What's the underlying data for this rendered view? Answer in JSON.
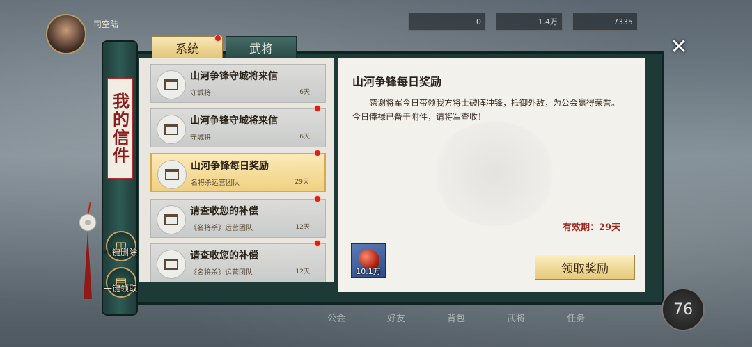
{
  "hud": {
    "player_name": "司空陆",
    "currency1": "0",
    "currency2": "1.4万",
    "currency3": "7335"
  },
  "left_scroll": {
    "title": "我的信件",
    "delete_all_label": "一键删除",
    "claim_all_label": "一键领取"
  },
  "tabs": [
    {
      "label": "系统",
      "active": true
    },
    {
      "label": "武将",
      "active": false
    }
  ],
  "mails": [
    {
      "title": "山河争锋守城将来信",
      "sender": "守城将",
      "days": "6天",
      "unread": true,
      "selected": false
    },
    {
      "title": "山河争锋守城将来信",
      "sender": "守城将",
      "days": "6天",
      "unread": true,
      "selected": false
    },
    {
      "title": "山河争锋每日奖励",
      "sender": "名将杀运营团队",
      "days": "29天",
      "unread": true,
      "selected": true
    },
    {
      "title": "请查收您的补偿",
      "sender": "《名将杀》运营团队",
      "days": "12天",
      "unread": true,
      "selected": false
    },
    {
      "title": "请查收您的补偿",
      "sender": "《名将杀》运营团队",
      "days": "12天",
      "unread": true,
      "selected": false
    }
  ],
  "detail": {
    "title": "山河争锋每日奖励",
    "body": "感谢将军今日带领我方将士破阵冲锋，抵御外敌，为公会赢得荣誉。今日俸禄已备于附件，请将军查收！",
    "validity": "有效期：29天",
    "attachment_count": "10.1万",
    "claim_label": "领取奖励"
  },
  "bottom_nav": [
    "公会",
    "好友",
    "背包",
    "武将",
    "任务"
  ],
  "level": "76",
  "colors": {
    "accent_red": "#a0261e",
    "tab_gold": "#e3c779",
    "panel_teal": "#1d3a37"
  }
}
